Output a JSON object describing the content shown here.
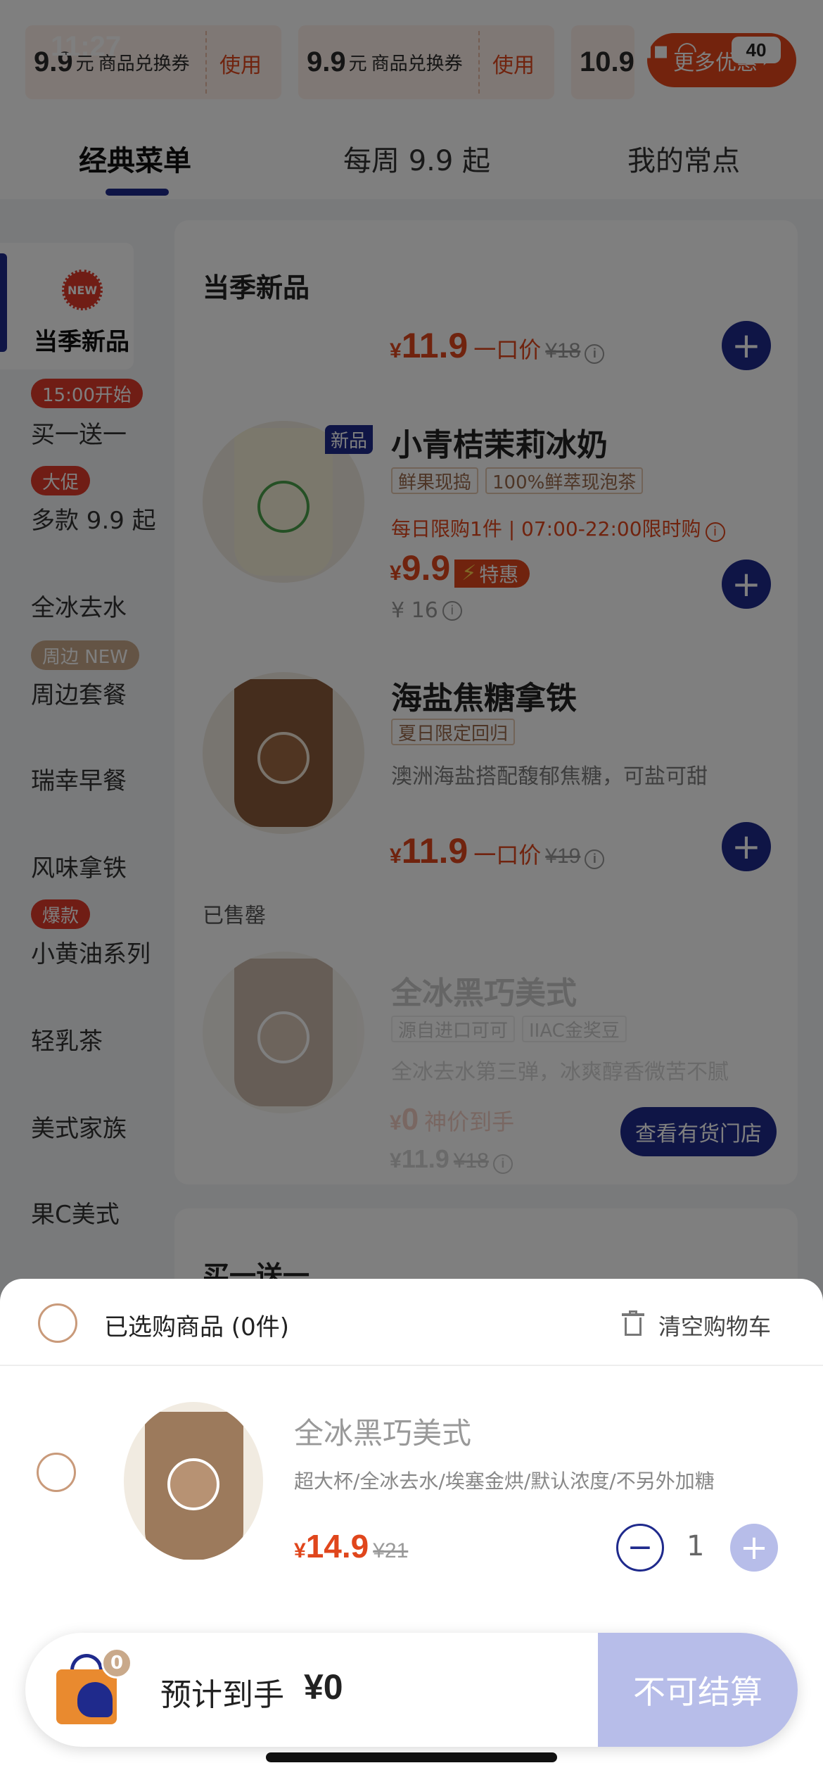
{
  "status_bar": {
    "time": "11:27",
    "battery": "40"
  },
  "coupons": [
    {
      "amount": "9.9",
      "unit": "元",
      "title": "商品兑换券",
      "use": "使用"
    },
    {
      "amount": "9.9",
      "unit": "元",
      "title": "商品兑换券",
      "use": "使用"
    },
    {
      "amount": "10.9",
      "unit": "",
      "title": "",
      "use": ""
    }
  ],
  "more_offers": "更多优惠",
  "tabs": [
    {
      "label": "经典菜单",
      "active": true
    },
    {
      "label": "每周 9.9 起",
      "active": false
    },
    {
      "label": "我的常点",
      "active": false
    }
  ],
  "sidebar": {
    "new_badge": "NEW",
    "items": [
      {
        "label": "当季新品",
        "tag": "",
        "active": true
      },
      {
        "label": "买一送一",
        "tag": "15:00开始",
        "tag_color": "#e03a2a"
      },
      {
        "label": "多款 9.9 起",
        "tag": "大促",
        "tag_color": "#e03a2a"
      },
      {
        "label": "全冰去水",
        "tag": ""
      },
      {
        "label": "周边套餐",
        "tag": "周边 NEW",
        "tag_color": "#c9a98a"
      },
      {
        "label": "瑞幸早餐",
        "tag": ""
      },
      {
        "label": "风味拿铁",
        "tag": ""
      },
      {
        "label": "小黄油系列",
        "tag": "爆款",
        "tag_color": "#e03a2a"
      },
      {
        "label": "轻乳茶",
        "tag": ""
      },
      {
        "label": "美式家族",
        "tag": ""
      },
      {
        "label": "果C美式",
        "tag": ""
      }
    ]
  },
  "section": {
    "title": "当季新品",
    "top_price": {
      "currency": "¥",
      "value": "11.9",
      "label": "一口价",
      "old": "¥18"
    },
    "products": [
      {
        "flag": "新品",
        "name": "小青桔茉莉冰奶",
        "tags": [
          "鲜果现捣",
          "100%鲜萃现泡茶"
        ],
        "limit": "每日限购1件 | 07:00-22:00限时购",
        "price": "9.9",
        "special": "特惠",
        "old": "¥ 16"
      },
      {
        "name": "海盐焦糖拿铁",
        "tags": [
          "夏日限定回归"
        ],
        "desc": "澳洲海盐搭配馥郁焦糖，可盐可甜",
        "price": "11.9",
        "label": "一口价",
        "old": "¥19"
      }
    ],
    "soldout_label": "已售罄",
    "soldout_product": {
      "name": "全冰黑巧美式",
      "tags": [
        "源自进口可可",
        "IIAC金奖豆"
      ],
      "desc": "全冰去水第三弹，冰爽醇香微苦不腻",
      "price": "0",
      "label": "神价到手",
      "price2": "11.9",
      "old": "¥18",
      "store_button": "查看有货门店"
    },
    "next_title": "买一送一"
  },
  "cart": {
    "title": "已选购商品 (0件)",
    "clear": "清空购物车",
    "item": {
      "name": "全冰黑巧美式",
      "spec": "超大杯/全冰去水/埃塞金烘/默认浓度/不另外加糖",
      "currency": "¥",
      "price": "14.9",
      "old": "¥21",
      "qty": "1"
    }
  },
  "bottom": {
    "bag_count": "0",
    "est_label": "预计到手",
    "est_amount": "¥0",
    "checkout": "不可结算"
  },
  "colors": {
    "brand": "#1f2a8c",
    "accent": "#e0461c",
    "disabled": "#b7bde9"
  }
}
